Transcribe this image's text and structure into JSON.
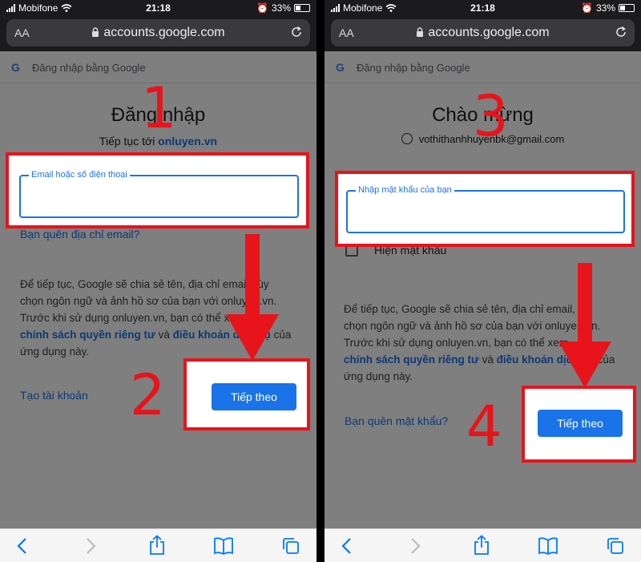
{
  "status_bar": {
    "carrier": "Mobifone",
    "time": "21:18",
    "battery": "33%"
  },
  "browser": {
    "text_size": "AA",
    "url": "accounts.google.com"
  },
  "google_bar": {
    "title": "Đăng nhập bằng Google"
  },
  "screen1": {
    "step_number": "1",
    "title": "Đăng nhập",
    "subtitle_prefix": "Tiếp tục tới",
    "subtitle_link": "onluyen.vn",
    "email_label": "Email hoặc số điện thoại",
    "forgot_email": "Bạn quên địa chỉ email?",
    "para_line1": "Để tiếp tục, Google sẽ chia sẻ tên, địa chỉ email, tùy",
    "para_line2": "chọn ngôn ngữ và ảnh hồ sơ của bạn với onluyen.vn.",
    "para_line3": "Trước khi sử dụng onluyen.vn, bạn có thể xem",
    "privacy_link": "chính sách quyền riêng tư",
    "and_text": "và",
    "terms_link": "điều khoản dịch vụ",
    "of_text": "của",
    "para_line5": "ứng dụng này.",
    "create_account": "Tạo tài khoản",
    "next_button": "Tiếp theo",
    "next_step_number": "2"
  },
  "screen2": {
    "step_number": "3",
    "title": "Chào mừng",
    "account_email": "vothithanhhuyenbk@gmail.com",
    "password_label": "Nhập mật khẩu của bạn",
    "show_password": "Hiện mật khẩu",
    "para_line1": "Để tiếp tục, Google sẽ chia sẻ tên, địa chỉ email,",
    "para_line2": "chọn ngôn ngữ và ảnh hồ sơ của bạn với onluyen.vn.",
    "para_line3": "Trước khi sử dụng onluyen.vn, bạn có thể xem",
    "privacy_link": "chính sách quyền riêng tư",
    "and_text": "và",
    "terms_link": "điều khoản dịch vụ",
    "of_text": "của",
    "para_line5": "ứng dụng này.",
    "forgot_password": "Bạn quên mật khẩu?",
    "next_button": "Tiếp theo",
    "next_step_number": "4"
  },
  "colors": {
    "highlight": "#e8131b",
    "accent": "#1a73e8"
  },
  "icons": [
    "wifi-icon",
    "lock-icon",
    "reload-icon",
    "google-g-icon",
    "account-icon",
    "back-icon",
    "forward-icon",
    "share-icon",
    "bookmarks-icon",
    "tabs-icon"
  ]
}
